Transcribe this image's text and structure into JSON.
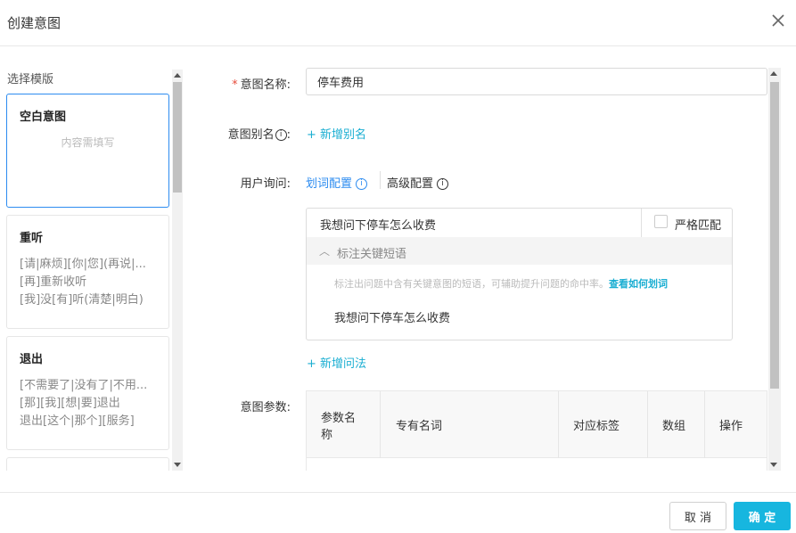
{
  "dialog": {
    "title": "创建意图",
    "close_icon": "close-icon"
  },
  "templates": {
    "label": "选择模版",
    "cards": [
      {
        "title": "空白意图",
        "empty_text": "内容需填写"
      },
      {
        "title": "重听",
        "lines": [
          "[请|麻烦][你|您](再说|...",
          "[再]重新收听",
          "[我]没[有]听(清楚|明白)"
        ]
      },
      {
        "title": "退出",
        "lines": [
          "[不需要了|没有了|不用...",
          "[那][我][想|要]退出",
          "退出[这个|那个][服务]"
        ]
      }
    ]
  },
  "form": {
    "name_label": "意图名称:",
    "name_value": "停车费用",
    "alias_label": "意图别名",
    "alias_info": "i",
    "alias_add": "+ 新增别名",
    "query_label": "用户询问:",
    "tab_word": "划词配置",
    "tab_advanced": "高级配置",
    "query_text": "我想问下停车怎么收费",
    "strict_match": "严格匹配",
    "keyword_toggle": "标注关键短语",
    "keyword_hint": "标注出问题中含有关键意图的短语，可辅助提升问题的命中率。",
    "keyword_hint_link": "查看如何划词",
    "keyword_sample": "我想问下停车怎么收费",
    "add_query": "+ 新增问法",
    "params_label": "意图参数:",
    "params_columns": [
      "参数名称",
      "专有名词",
      "对应标签",
      "数组",
      "操作"
    ]
  },
  "footer": {
    "cancel": "取 消",
    "confirm": "确 定"
  },
  "colors": {
    "accent": "#17b6df",
    "link": "#1aaed2",
    "active_border": "#2d8cf0",
    "required": "#e74c3c"
  }
}
